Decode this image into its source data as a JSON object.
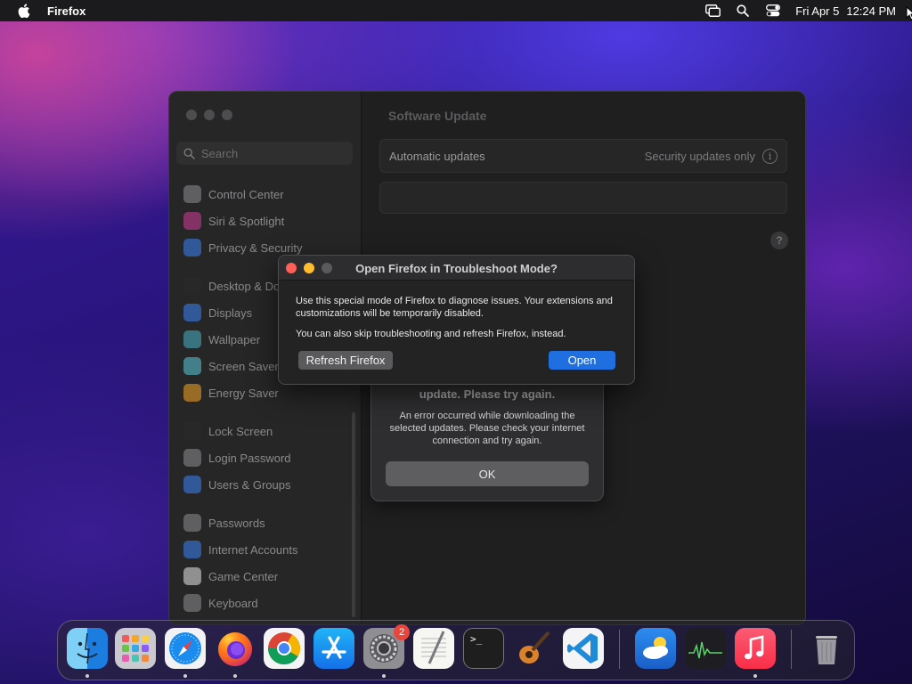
{
  "menubar": {
    "app_name": "Firefox",
    "date": "Fri Apr 5",
    "time": "12:24 PM",
    "icons": [
      "apple-icon",
      "screen-mirroring-icon",
      "spotlight-search-icon",
      "control-center-icon"
    ]
  },
  "settings": {
    "search_placeholder": "Search",
    "sidebar_items": [
      {
        "label": "Control Center",
        "color": "#8e8e93"
      },
      {
        "label": "Siri & Spotlight",
        "color": "#d23c9a"
      },
      {
        "label": "Privacy & Security",
        "color": "#3b82f6"
      },
      {
        "label": "Desktop & Dock",
        "color": "#2a2a2c"
      },
      {
        "label": "Displays",
        "color": "#3b82f6"
      },
      {
        "label": "Wallpaper",
        "color": "#48b3c9"
      },
      {
        "label": "Screen Saver",
        "color": "#5ac8d8"
      },
      {
        "label": "Energy Saver",
        "color": "#f5a623"
      },
      {
        "label": "Lock Screen",
        "color": "#2a2a2c"
      },
      {
        "label": "Login Password",
        "color": "#8e8e93"
      },
      {
        "label": "Users & Groups",
        "color": "#3b82f6"
      },
      {
        "label": "Passwords",
        "color": "#8e8e93"
      },
      {
        "label": "Internet Accounts",
        "color": "#3b82f6"
      },
      {
        "label": "Game Center",
        "color": "#e8e8ea"
      },
      {
        "label": "Keyboard",
        "color": "#8e8e93"
      }
    ],
    "page_title": "Software Update",
    "automatic_updates_label": "Automatic updates",
    "automatic_updates_value": "Security updates only",
    "info_glyph": "i",
    "help_glyph": "?"
  },
  "error_sheet": {
    "title": "update. Please try again.",
    "message": "An error occurred while downloading the selected updates. Please check your internet connection and try again.",
    "ok_label": "OK"
  },
  "firefox_dialog": {
    "title": "Open Firefox in Troubleshoot Mode?",
    "body_1": "Use this special mode of Firefox to diagnose issues. Your extensions and customizations will be temporarily disabled.",
    "body_2": "You can also skip troubleshooting and refresh Firefox, instead.",
    "refresh_label": "Refresh Firefox",
    "open_label": "Open",
    "traffic_colors": [
      "#ff5f57",
      "#febc2e",
      "#5a5a5c"
    ]
  },
  "dock": {
    "items": [
      {
        "name": "finder",
        "running": true
      },
      {
        "name": "launchpad",
        "running": false
      },
      {
        "name": "safari",
        "running": true
      },
      {
        "name": "firefox",
        "running": true
      },
      {
        "name": "chrome",
        "running": false
      },
      {
        "name": "app-store",
        "running": false
      },
      {
        "name": "system-settings",
        "running": true,
        "badge": "2"
      },
      {
        "name": "textedit",
        "running": false
      },
      {
        "name": "terminal",
        "running": false
      },
      {
        "name": "garageband",
        "running": false
      },
      {
        "name": "vscode",
        "running": false
      },
      {
        "name": "weather",
        "running": false
      },
      {
        "name": "activity-monitor",
        "running": false
      },
      {
        "name": "music",
        "running": true
      },
      {
        "name": "trash",
        "running": false
      }
    ],
    "terminal_prompt": ">_"
  }
}
